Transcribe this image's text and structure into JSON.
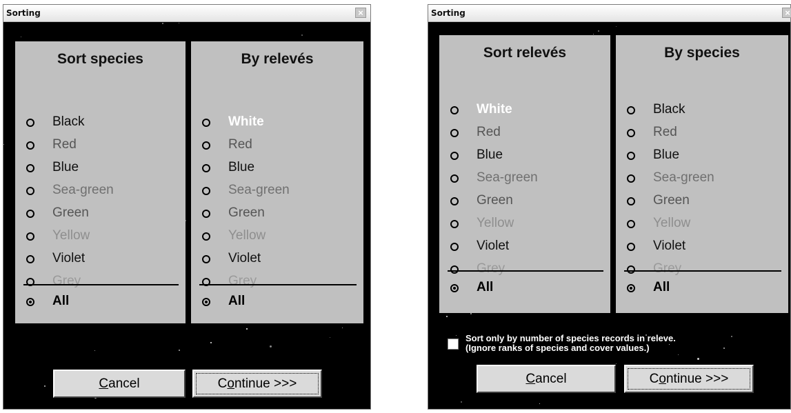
{
  "dialogs": [
    {
      "title": "Sorting",
      "close_glyph": "×",
      "left_panel": {
        "title": "Sort species",
        "options": [
          {
            "label": "Black",
            "color": "#0d0d0d",
            "selected": false
          },
          {
            "label": "Red",
            "color": "#555555",
            "selected": false
          },
          {
            "label": "Blue",
            "color": "#111111",
            "selected": false
          },
          {
            "label": "Sea-green",
            "color": "#707070",
            "selected": false
          },
          {
            "label": "Green",
            "color": "#555555",
            "selected": false
          },
          {
            "label": "Yellow",
            "color": "#8e8e8e",
            "selected": false
          },
          {
            "label": "Violet",
            "color": "#111111",
            "selected": false
          },
          {
            "label": "Grey",
            "color": "#9a9a9a",
            "selected": false
          }
        ],
        "all_label": "All",
        "all_selected": true
      },
      "right_panel": {
        "title": "By relevés",
        "options": [
          {
            "label": "White",
            "color": "#ffffff",
            "selected": false
          },
          {
            "label": "Red",
            "color": "#555555",
            "selected": false
          },
          {
            "label": "Blue",
            "color": "#111111",
            "selected": false
          },
          {
            "label": "Sea-green",
            "color": "#707070",
            "selected": false
          },
          {
            "label": "Green",
            "color": "#555555",
            "selected": false
          },
          {
            "label": "Yellow",
            "color": "#8e8e8e",
            "selected": false
          },
          {
            "label": "Violet",
            "color": "#111111",
            "selected": false
          },
          {
            "label": "Grey",
            "color": "#9a9a9a",
            "selected": false
          }
        ],
        "all_label": "All",
        "all_selected": true
      },
      "cancel_label_pre": "",
      "cancel_label_u": "C",
      "cancel_label_post": "ancel",
      "continue_label_pre": "C",
      "continue_label_u": "o",
      "continue_label_post": "ntinue >>>"
    },
    {
      "title": "Sorting",
      "close_glyph": "×",
      "left_panel": {
        "title": "Sort relevés",
        "options": [
          {
            "label": "White",
            "color": "#ffffff",
            "selected": false
          },
          {
            "label": "Red",
            "color": "#555555",
            "selected": false
          },
          {
            "label": "Blue",
            "color": "#111111",
            "selected": false
          },
          {
            "label": "Sea-green",
            "color": "#707070",
            "selected": false
          },
          {
            "label": "Green",
            "color": "#555555",
            "selected": false
          },
          {
            "label": "Yellow",
            "color": "#8e8e8e",
            "selected": false
          },
          {
            "label": "Violet",
            "color": "#111111",
            "selected": false
          },
          {
            "label": "Grey",
            "color": "#9a9a9a",
            "selected": false
          }
        ],
        "all_label": "All",
        "all_selected": true
      },
      "right_panel": {
        "title": "By species",
        "options": [
          {
            "label": "Black",
            "color": "#0d0d0d",
            "selected": false
          },
          {
            "label": "Red",
            "color": "#555555",
            "selected": false
          },
          {
            "label": "Blue",
            "color": "#111111",
            "selected": false
          },
          {
            "label": "Sea-green",
            "color": "#707070",
            "selected": false
          },
          {
            "label": "Green",
            "color": "#555555",
            "selected": false
          },
          {
            "label": "Yellow",
            "color": "#8e8e8e",
            "selected": false
          },
          {
            "label": "Violet",
            "color": "#111111",
            "selected": false
          },
          {
            "label": "Grey",
            "color": "#9a9a9a",
            "selected": false
          }
        ],
        "all_label": "All",
        "all_selected": true
      },
      "checkbox": {
        "checked": false,
        "line1": "Sort only by number of species records in releve.",
        "line2": "(Ignore ranks of species and cover values.)"
      },
      "cancel_label_pre": "",
      "cancel_label_u": "C",
      "cancel_label_post": "ancel",
      "continue_label_pre": "C",
      "continue_label_u": "o",
      "continue_label_post": "ntinue >>>"
    }
  ],
  "theme": {
    "panel_bg": "#c0c0c0",
    "starfield_bg": "#000000",
    "all_option_color": "#000000"
  }
}
